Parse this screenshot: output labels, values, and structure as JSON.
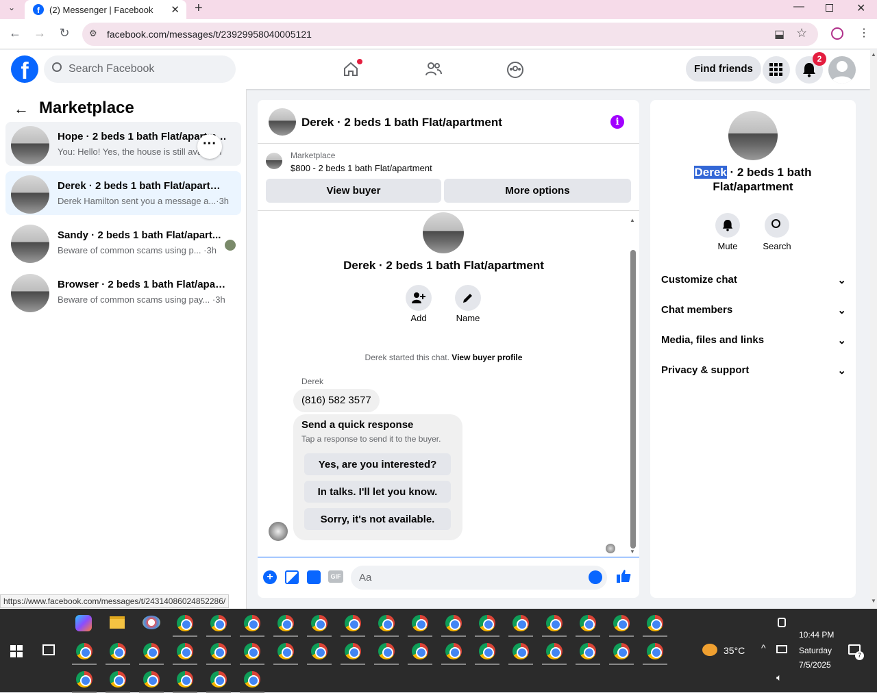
{
  "browser": {
    "tab_title": "(2) Messenger | Facebook",
    "url": "facebook.com/messages/t/23929958040005121",
    "status_url": "https://www.facebook.com/messages/t/24314086024852286/"
  },
  "header": {
    "search_placeholder": "Search Facebook",
    "find_friends": "Find friends",
    "notification_count": "2"
  },
  "sidebar": {
    "title": "Marketplace",
    "conversations": [
      {
        "title": "Hope · 2 beds 1 bath Flat/apartment",
        "preview": "You: Hello! Yes, the house is still avai... m",
        "time": ""
      },
      {
        "title": "Derek · 2 beds 1 bath Flat/apartme...",
        "preview": "Derek Hamilton sent you a message a...",
        "time": "·3h"
      },
      {
        "title": "Sandy · 2 beds 1 bath Flat/apart...",
        "preview": "Beware of common scams using p...",
        "time": "·3h"
      },
      {
        "title": "Browser · 2 beds 1 bath Flat/apart...",
        "preview": "Beware of common scams using pay...",
        "time": "·3h"
      }
    ]
  },
  "chat": {
    "title": "Derek · 2 beds 1 bath Flat/apartment",
    "marketplace_label": "Marketplace",
    "listing": "$800 - 2 beds 1 bath Flat/apartment",
    "view_buyer": "View buyer",
    "more_options": "More options",
    "profile_name": "Derek · 2 beds 1 bath Flat/apartment",
    "add_label": "Add",
    "name_label": "Name",
    "started_text": "Derek started this chat.",
    "view_buyer_profile": "View buyer profile",
    "sender": "Derek",
    "message": "(816) 582 3577",
    "quick_title": "Send a quick response",
    "quick_sub": "Tap a response to send it to the buyer.",
    "quick_responses": [
      "Yes, are you interested?",
      "In talks. I'll let you know.",
      "Sorry, it's not available."
    ],
    "composer_placeholder": "Aa"
  },
  "details": {
    "name_highlight": "Derek",
    "name_rest_1": " · 2 beds 1 bath",
    "name_rest_2": "Flat/apartment",
    "mute": "Mute",
    "search": "Search",
    "sections": [
      "Customize chat",
      "Chat members",
      "Media, files and links",
      "Privacy & support"
    ]
  },
  "taskbar": {
    "temperature": "35°C",
    "time": "10:44 PM",
    "day": "Saturday",
    "date": "7/5/2025",
    "notif_count": "7"
  }
}
